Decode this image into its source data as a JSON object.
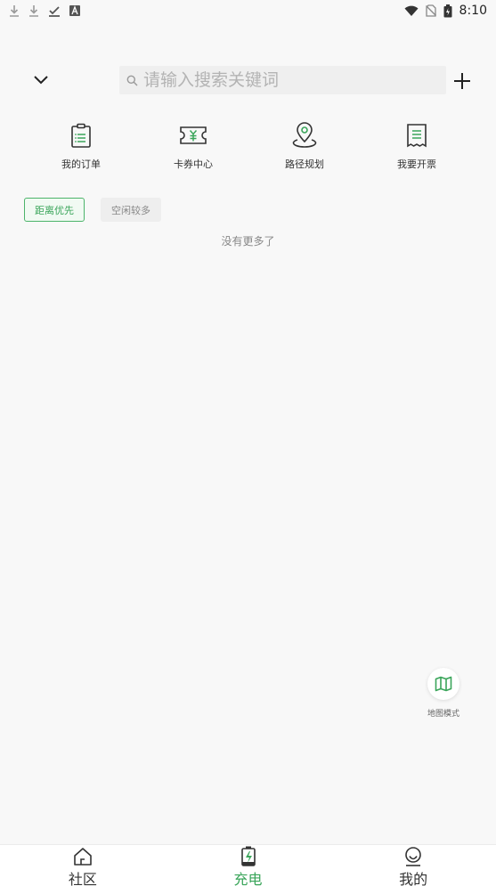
{
  "status_bar": {
    "time": "8:10",
    "icons": [
      "download-icon",
      "download-icon",
      "check-icon",
      "a-icon",
      "wifi-icon",
      "no-sim-icon",
      "battery-icon"
    ]
  },
  "header": {
    "search": {
      "placeholder": "请输入搜索关键词",
      "value": ""
    }
  },
  "quick_actions": [
    {
      "label": "我的订单",
      "icon": "clipboard-icon"
    },
    {
      "label": "卡券中心",
      "icon": "ticket-icon"
    },
    {
      "label": "路径规划",
      "icon": "location-pin-icon"
    },
    {
      "label": "我要开票",
      "icon": "receipt-icon"
    }
  ],
  "filters": [
    {
      "label": "距离优先",
      "active": true
    },
    {
      "label": "空闲较多",
      "active": false
    }
  ],
  "list": {
    "empty_text": "没有更多了"
  },
  "map_mode": {
    "label": "地图模式",
    "icon": "map-icon"
  },
  "tab_bar": {
    "tabs": [
      {
        "label": "社区",
        "icon": "home-icon",
        "active": false
      },
      {
        "label": "充电",
        "icon": "charging-icon",
        "active": true
      },
      {
        "label": "我的",
        "icon": "profile-icon",
        "active": false
      }
    ]
  },
  "colors": {
    "accent": "#3aa55a",
    "background": "#f8f8f8"
  }
}
